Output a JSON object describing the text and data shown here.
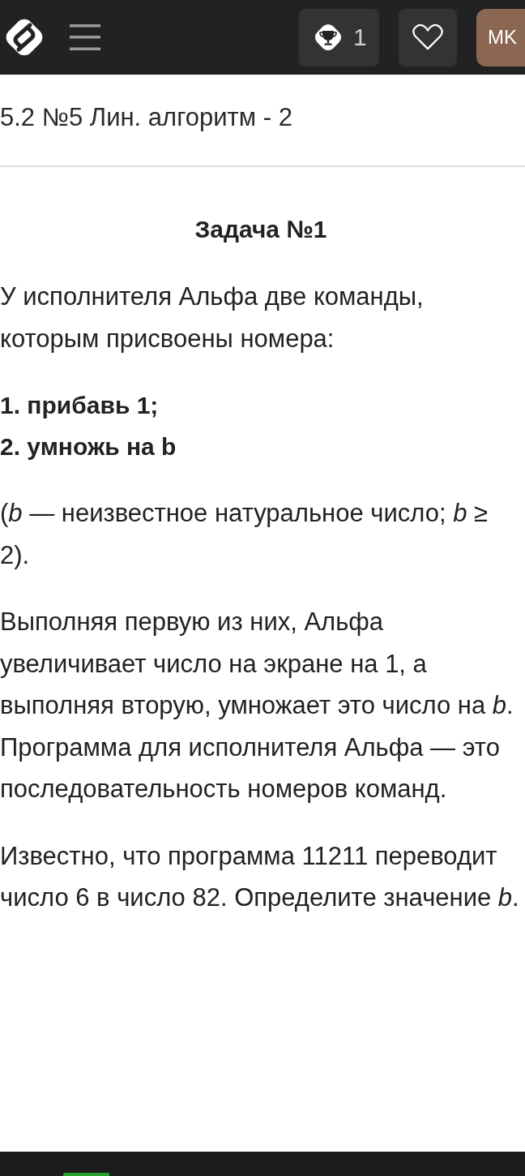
{
  "header": {
    "trophy_count": "1",
    "avatar_initials": "MK"
  },
  "lesson": {
    "title": "5.2 №5 Лин. алгоритм - 2"
  },
  "task": {
    "heading": "Задача №1",
    "blocks": [
      {
        "kind": "paragraph",
        "text": "У исполнителя Альфа две команды, которым присвоены номера:"
      },
      {
        "kind": "commands",
        "items": [
          "1. прибавь 1;",
          "2. умножь на b"
        ]
      },
      {
        "kind": "paragraph",
        "text": "(*b* — неизвестное натуральное число; *b* ≥ 2)."
      },
      {
        "kind": "paragraph",
        "text": "Выполняя первую из них, Альфа увеличивает число на экране на 1, а выполняя вторую, умножает это число на *b*. Программа для исполнителя Альфа — это последовательность номеров команд."
      },
      {
        "kind": "paragraph",
        "text": "Известно, что программа 11211 переводит число 6 в число 82. Определите значение *b*."
      }
    ]
  }
}
